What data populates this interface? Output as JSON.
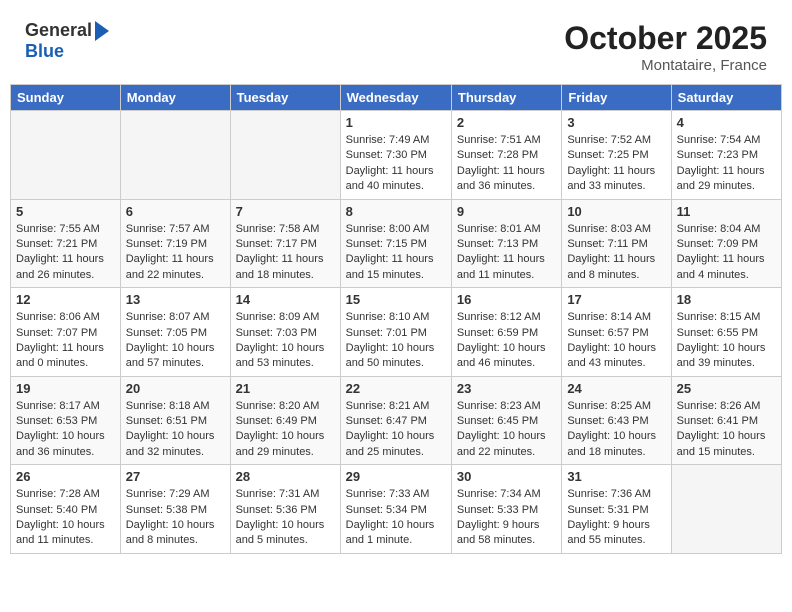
{
  "logo": {
    "general": "General",
    "blue": "Blue"
  },
  "title": "October 2025",
  "location": "Montataire, France",
  "days_of_week": [
    "Sunday",
    "Monday",
    "Tuesday",
    "Wednesday",
    "Thursday",
    "Friday",
    "Saturday"
  ],
  "weeks": [
    [
      {
        "day": "",
        "info": ""
      },
      {
        "day": "",
        "info": ""
      },
      {
        "day": "",
        "info": ""
      },
      {
        "day": "1",
        "info": "Sunrise: 7:49 AM\nSunset: 7:30 PM\nDaylight: 11 hours\nand 40 minutes."
      },
      {
        "day": "2",
        "info": "Sunrise: 7:51 AM\nSunset: 7:28 PM\nDaylight: 11 hours\nand 36 minutes."
      },
      {
        "day": "3",
        "info": "Sunrise: 7:52 AM\nSunset: 7:25 PM\nDaylight: 11 hours\nand 33 minutes."
      },
      {
        "day": "4",
        "info": "Sunrise: 7:54 AM\nSunset: 7:23 PM\nDaylight: 11 hours\nand 29 minutes."
      }
    ],
    [
      {
        "day": "5",
        "info": "Sunrise: 7:55 AM\nSunset: 7:21 PM\nDaylight: 11 hours\nand 26 minutes."
      },
      {
        "day": "6",
        "info": "Sunrise: 7:57 AM\nSunset: 7:19 PM\nDaylight: 11 hours\nand 22 minutes."
      },
      {
        "day": "7",
        "info": "Sunrise: 7:58 AM\nSunset: 7:17 PM\nDaylight: 11 hours\nand 18 minutes."
      },
      {
        "day": "8",
        "info": "Sunrise: 8:00 AM\nSunset: 7:15 PM\nDaylight: 11 hours\nand 15 minutes."
      },
      {
        "day": "9",
        "info": "Sunrise: 8:01 AM\nSunset: 7:13 PM\nDaylight: 11 hours\nand 11 minutes."
      },
      {
        "day": "10",
        "info": "Sunrise: 8:03 AM\nSunset: 7:11 PM\nDaylight: 11 hours\nand 8 minutes."
      },
      {
        "day": "11",
        "info": "Sunrise: 8:04 AM\nSunset: 7:09 PM\nDaylight: 11 hours\nand 4 minutes."
      }
    ],
    [
      {
        "day": "12",
        "info": "Sunrise: 8:06 AM\nSunset: 7:07 PM\nDaylight: 11 hours\nand 0 minutes."
      },
      {
        "day": "13",
        "info": "Sunrise: 8:07 AM\nSunset: 7:05 PM\nDaylight: 10 hours\nand 57 minutes."
      },
      {
        "day": "14",
        "info": "Sunrise: 8:09 AM\nSunset: 7:03 PM\nDaylight: 10 hours\nand 53 minutes."
      },
      {
        "day": "15",
        "info": "Sunrise: 8:10 AM\nSunset: 7:01 PM\nDaylight: 10 hours\nand 50 minutes."
      },
      {
        "day": "16",
        "info": "Sunrise: 8:12 AM\nSunset: 6:59 PM\nDaylight: 10 hours\nand 46 minutes."
      },
      {
        "day": "17",
        "info": "Sunrise: 8:14 AM\nSunset: 6:57 PM\nDaylight: 10 hours\nand 43 minutes."
      },
      {
        "day": "18",
        "info": "Sunrise: 8:15 AM\nSunset: 6:55 PM\nDaylight: 10 hours\nand 39 minutes."
      }
    ],
    [
      {
        "day": "19",
        "info": "Sunrise: 8:17 AM\nSunset: 6:53 PM\nDaylight: 10 hours\nand 36 minutes."
      },
      {
        "day": "20",
        "info": "Sunrise: 8:18 AM\nSunset: 6:51 PM\nDaylight: 10 hours\nand 32 minutes."
      },
      {
        "day": "21",
        "info": "Sunrise: 8:20 AM\nSunset: 6:49 PM\nDaylight: 10 hours\nand 29 minutes."
      },
      {
        "day": "22",
        "info": "Sunrise: 8:21 AM\nSunset: 6:47 PM\nDaylight: 10 hours\nand 25 minutes."
      },
      {
        "day": "23",
        "info": "Sunrise: 8:23 AM\nSunset: 6:45 PM\nDaylight: 10 hours\nand 22 minutes."
      },
      {
        "day": "24",
        "info": "Sunrise: 8:25 AM\nSunset: 6:43 PM\nDaylight: 10 hours\nand 18 minutes."
      },
      {
        "day": "25",
        "info": "Sunrise: 8:26 AM\nSunset: 6:41 PM\nDaylight: 10 hours\nand 15 minutes."
      }
    ],
    [
      {
        "day": "26",
        "info": "Sunrise: 7:28 AM\nSunset: 5:40 PM\nDaylight: 10 hours\nand 11 minutes."
      },
      {
        "day": "27",
        "info": "Sunrise: 7:29 AM\nSunset: 5:38 PM\nDaylight: 10 hours\nand 8 minutes."
      },
      {
        "day": "28",
        "info": "Sunrise: 7:31 AM\nSunset: 5:36 PM\nDaylight: 10 hours\nand 5 minutes."
      },
      {
        "day": "29",
        "info": "Sunrise: 7:33 AM\nSunset: 5:34 PM\nDaylight: 10 hours\nand 1 minute."
      },
      {
        "day": "30",
        "info": "Sunrise: 7:34 AM\nSunset: 5:33 PM\nDaylight: 9 hours\nand 58 minutes."
      },
      {
        "day": "31",
        "info": "Sunrise: 7:36 AM\nSunset: 5:31 PM\nDaylight: 9 hours\nand 55 minutes."
      },
      {
        "day": "",
        "info": ""
      }
    ]
  ]
}
